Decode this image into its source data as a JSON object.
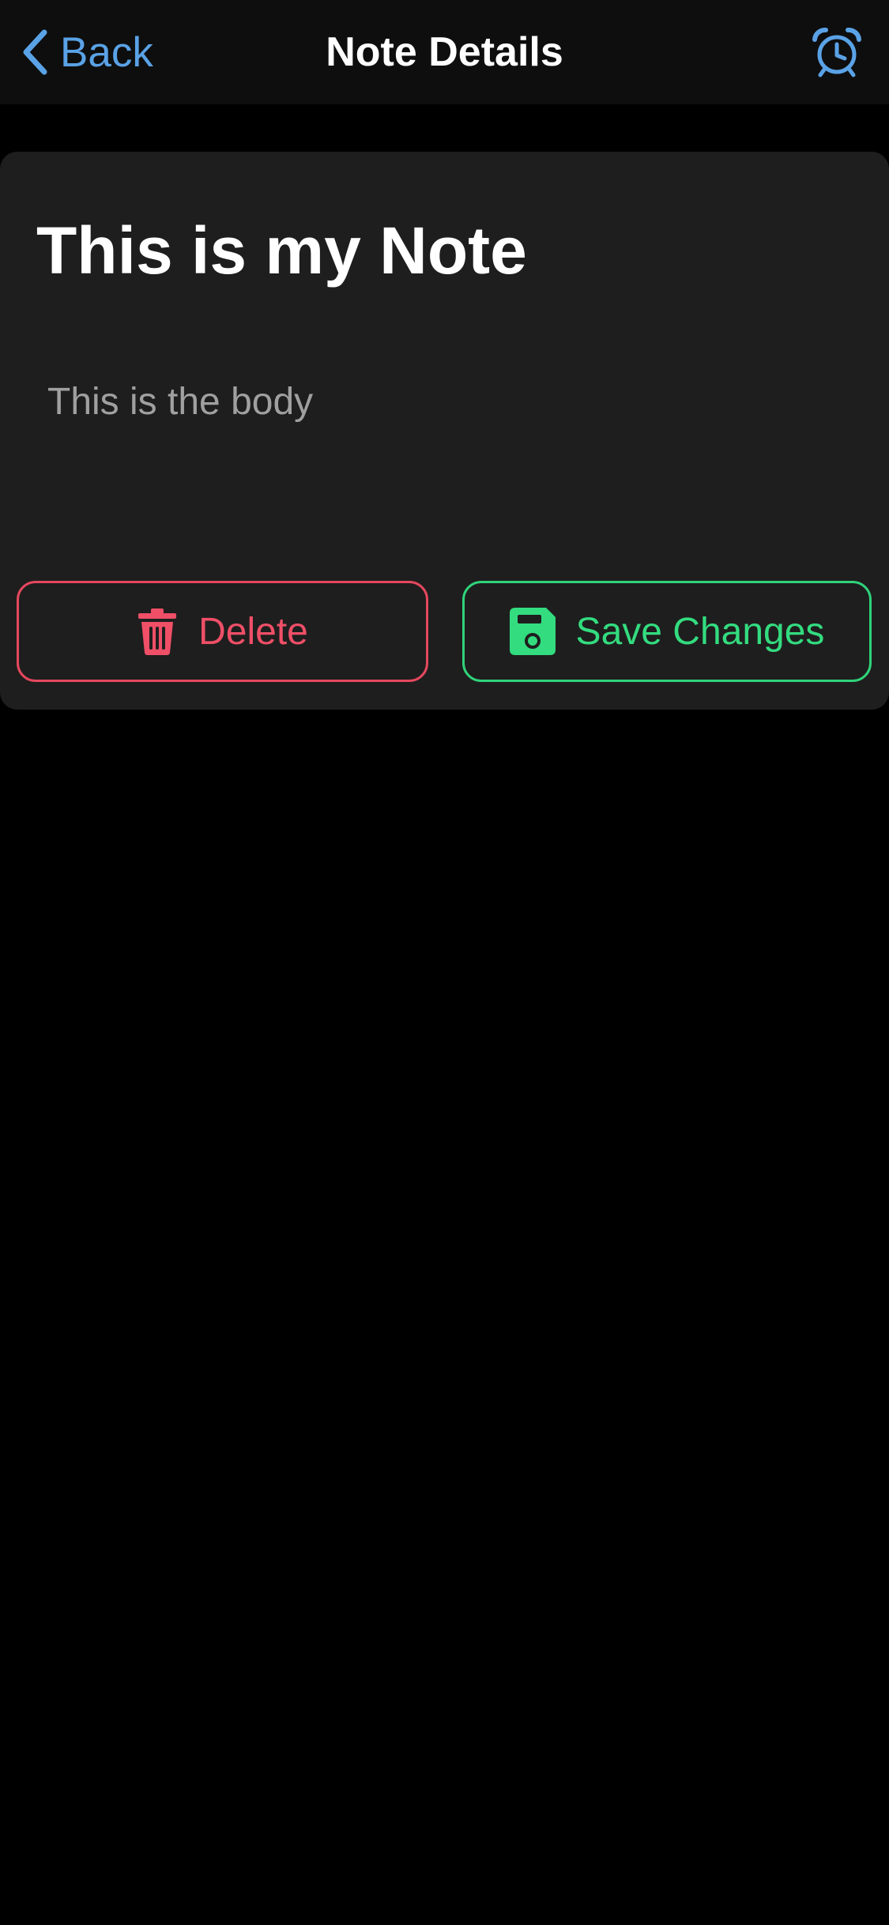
{
  "header": {
    "back_label": "Back",
    "title": "Note Details",
    "back_icon": "chevron-left-icon",
    "alarm_icon": "alarm-clock-icon"
  },
  "note": {
    "title": "This is my Note",
    "body": "This is the body"
  },
  "actions": {
    "delete_label": "Delete",
    "delete_icon": "trash-icon",
    "save_label": "Save Changes",
    "save_icon": "floppy-disk-icon"
  },
  "colors": {
    "background": "#000000",
    "header_bg": "#0e0e0e",
    "card_bg": "#1e1e1e",
    "accent_blue": "#5aa2e6",
    "danger": "#ef4f67",
    "success": "#33dc7f",
    "body_text": "#a0a0a0"
  }
}
